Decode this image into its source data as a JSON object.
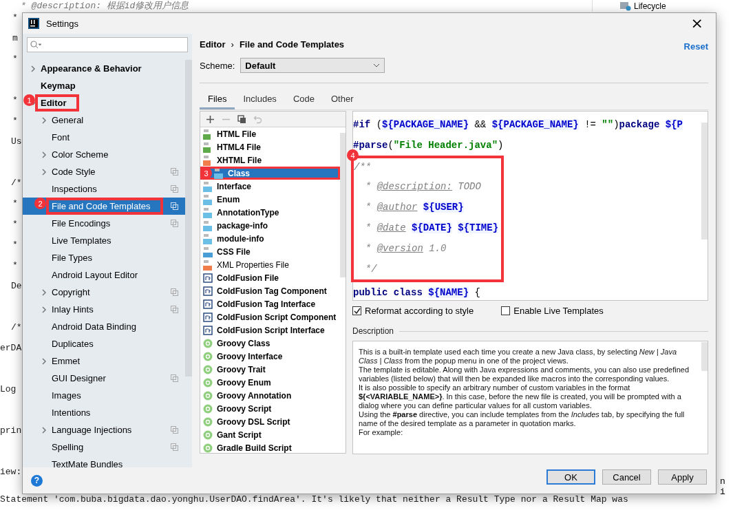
{
  "background_editor": {
    "lines": [
      {
        "text": "* @description: 根据id修改用户信息"
      },
      {
        "text": "*"
      },
      {
        "text": "m"
      },
      {
        "text": "*"
      },
      {
        "text": "*"
      },
      {
        "text": "*"
      },
      {
        "text": "Us"
      },
      {
        "text": "/*"
      },
      {
        "text": "*"
      },
      {
        "text": "*"
      },
      {
        "text": "*"
      },
      {
        "text": "*"
      },
      {
        "text": "De"
      },
      {
        "text": "/*"
      },
      {
        "text": "erDA"
      },
      {
        "text": "Log"
      },
      {
        "text": "prin"
      },
      {
        "text": "iew:"
      },
      {
        "text": "Statement 'com.buba.bigdata.dao.yonghu.UserDAO.findArea'. It's likely that neither a Result Type nor a Result Map was"
      }
    ],
    "project_tree_item": "Lifecycle",
    "right_fragment": "n i"
  },
  "window": {
    "title": "Settings",
    "close": "×"
  },
  "sidebar": {
    "items": [
      {
        "label": "Appearance & Behavior",
        "expandable": true,
        "expanded": false,
        "selected": false,
        "project_level": false
      },
      {
        "label": "Keymap",
        "expandable": false,
        "expanded": false,
        "selected": false,
        "project_level": false
      },
      {
        "label": "Editor",
        "expandable": true,
        "expanded": true,
        "selected": false,
        "project_level": false,
        "annotation": "1",
        "children": [
          {
            "label": "General",
            "expandable": true,
            "expanded": false,
            "selected": false,
            "project_level": false
          },
          {
            "label": "Font",
            "expandable": false,
            "expanded": false,
            "selected": false,
            "project_level": false
          },
          {
            "label": "Color Scheme",
            "expandable": true,
            "expanded": false,
            "selected": false,
            "project_level": false
          },
          {
            "label": "Code Style",
            "expandable": true,
            "expanded": false,
            "selected": false,
            "project_level": true
          },
          {
            "label": "Inspections",
            "expandable": false,
            "expanded": false,
            "selected": false,
            "project_level": true
          },
          {
            "label": "File and Code Templates",
            "expandable": false,
            "expanded": false,
            "selected": true,
            "project_level": true,
            "annotation": "2"
          },
          {
            "label": "File Encodings",
            "expandable": false,
            "expanded": false,
            "selected": false,
            "project_level": true
          },
          {
            "label": "Live Templates",
            "expandable": false,
            "expanded": false,
            "selected": false,
            "project_level": false
          },
          {
            "label": "File Types",
            "expandable": false,
            "expanded": false,
            "selected": false,
            "project_level": false
          },
          {
            "label": "Android Layout Editor",
            "expandable": false,
            "expanded": false,
            "selected": false,
            "project_level": false
          },
          {
            "label": "Copyright",
            "expandable": true,
            "expanded": false,
            "selected": false,
            "project_level": true
          },
          {
            "label": "Inlay Hints",
            "expandable": true,
            "expanded": false,
            "selected": false,
            "project_level": true
          },
          {
            "label": "Android Data Binding",
            "expandable": false,
            "expanded": false,
            "selected": false,
            "project_level": false
          },
          {
            "label": "Duplicates",
            "expandable": false,
            "expanded": false,
            "selected": false,
            "project_level": false
          },
          {
            "label": "Emmet",
            "expandable": true,
            "expanded": false,
            "selected": false,
            "project_level": false
          },
          {
            "label": "GUI Designer",
            "expandable": false,
            "expanded": false,
            "selected": false,
            "project_level": true
          },
          {
            "label": "Images",
            "expandable": false,
            "expanded": false,
            "selected": false,
            "project_level": false
          },
          {
            "label": "Intentions",
            "expandable": false,
            "expanded": false,
            "selected": false,
            "project_level": false
          },
          {
            "label": "Language Injections",
            "expandable": true,
            "expanded": false,
            "selected": false,
            "project_level": true
          },
          {
            "label": "Spelling",
            "expandable": false,
            "expanded": false,
            "selected": false,
            "project_level": true
          },
          {
            "label": "TextMate Bundles",
            "expandable": false,
            "expanded": false,
            "selected": false,
            "project_level": false
          }
        ]
      }
    ]
  },
  "breadcrumb": [
    "Editor",
    "File and Code Templates"
  ],
  "breadcrumb_separator": "›",
  "reset": "Reset",
  "scheme": {
    "label": "Scheme:",
    "value": "Default"
  },
  "tabs": [
    {
      "label": "Files",
      "selected": true
    },
    {
      "label": "Includes",
      "selected": false
    },
    {
      "label": "Code",
      "selected": false
    },
    {
      "label": "Other",
      "selected": false
    }
  ],
  "toolbar": [
    {
      "kind": "add",
      "disabled": false
    },
    {
      "kind": "remove",
      "disabled": true
    },
    {
      "kind": "copy",
      "disabled": false
    },
    {
      "kind": "reset",
      "disabled": true
    }
  ],
  "templates": [
    {
      "name": "HTML File",
      "kind": "html",
      "bold": true,
      "selected": false
    },
    {
      "name": "HTML4 File",
      "kind": "html",
      "bold": true,
      "selected": false
    },
    {
      "name": "XHTML File",
      "kind": "xhtml",
      "bold": true,
      "selected": false
    },
    {
      "name": "Class",
      "kind": "java",
      "bold": true,
      "selected": true,
      "annotation": "3"
    },
    {
      "name": "Interface",
      "kind": "java",
      "bold": true,
      "selected": false
    },
    {
      "name": "Enum",
      "kind": "java",
      "bold": true,
      "selected": false
    },
    {
      "name": "AnnotationType",
      "kind": "java",
      "bold": true,
      "selected": false
    },
    {
      "name": "package-info",
      "kind": "java",
      "bold": true,
      "selected": false
    },
    {
      "name": "module-info",
      "kind": "java",
      "bold": true,
      "selected": false
    },
    {
      "name": "CSS File",
      "kind": "css",
      "bold": true,
      "selected": false
    },
    {
      "name": "XML Properties File",
      "kind": "xml",
      "bold": false,
      "selected": false
    },
    {
      "name": "ColdFusion File",
      "kind": "cf",
      "bold": true,
      "selected": false
    },
    {
      "name": "ColdFusion Tag Component",
      "kind": "cf",
      "bold": true,
      "selected": false
    },
    {
      "name": "ColdFusion Tag Interface",
      "kind": "cf",
      "bold": true,
      "selected": false
    },
    {
      "name": "ColdFusion Script Component",
      "kind": "cf",
      "bold": true,
      "selected": false
    },
    {
      "name": "ColdFusion Script Interface",
      "kind": "cf",
      "bold": true,
      "selected": false
    },
    {
      "name": "Groovy Class",
      "kind": "groovy",
      "bold": true,
      "selected": false
    },
    {
      "name": "Groovy Interface",
      "kind": "groovy",
      "bold": true,
      "selected": false
    },
    {
      "name": "Groovy Trait",
      "kind": "groovy",
      "bold": true,
      "selected": false
    },
    {
      "name": "Groovy Enum",
      "kind": "groovy",
      "bold": true,
      "selected": false
    },
    {
      "name": "Groovy Annotation",
      "kind": "groovy",
      "bold": true,
      "selected": false
    },
    {
      "name": "Groovy Script",
      "kind": "groovy",
      "bold": true,
      "selected": false
    },
    {
      "name": "Groovy DSL Script",
      "kind": "groovy",
      "bold": true,
      "selected": false
    },
    {
      "name": "Gant Script",
      "kind": "groovy",
      "bold": true,
      "selected": false
    },
    {
      "name": "Gradle Build Script",
      "kind": "groovy",
      "bold": true,
      "selected": false
    }
  ],
  "code": [
    {
      "lines": [
        [
          {
            "kind": "directive",
            "text": "#if"
          },
          {
            "kind": "plain",
            "text": " ("
          },
          {
            "kind": "var",
            "text": "${PACKAGE_NAME}"
          },
          {
            "kind": "plain",
            "text": " && "
          },
          {
            "kind": "var",
            "text": "${PACKAGE_NAME}"
          },
          {
            "kind": "plain",
            "text": " != "
          },
          {
            "kind": "string",
            "text": "\"\""
          },
          {
            "kind": "plain",
            "text": ")"
          },
          {
            "kind": "keyword",
            "text": "package"
          },
          {
            "kind": "var",
            "text": " ${P"
          }
        ],
        [
          {
            "kind": "directive",
            "text": "#parse"
          },
          {
            "kind": "plain",
            "text": "("
          },
          {
            "kind": "string",
            "text": "\"File Header.java\""
          },
          {
            "kind": "plain",
            "text": ")"
          }
        ]
      ]
    },
    {
      "annotation": "4",
      "lines": [
        [
          {
            "kind": "comment",
            "text": "/**"
          }
        ],
        [
          {
            "kind": "comment",
            "text": "  * "
          },
          {
            "kind": "tag",
            "text": "@description:"
          },
          {
            "kind": "comment",
            "text": " TODO"
          }
        ],
        [
          {
            "kind": "comment",
            "text": "  * "
          },
          {
            "kind": "tag",
            "text": "@author"
          },
          {
            "kind": "var",
            "text": " ${USER}"
          }
        ],
        [
          {
            "kind": "comment",
            "text": "  * "
          },
          {
            "kind": "tag",
            "text": "@date"
          },
          {
            "kind": "var",
            "text": " ${DATE}"
          },
          {
            "kind": "var",
            "text": " ${TIME}"
          }
        ],
        [
          {
            "kind": "comment",
            "text": "  * "
          },
          {
            "kind": "tag",
            "text": "@version"
          },
          {
            "kind": "comment",
            "text": " 1.0"
          }
        ],
        [
          {
            "kind": "comment",
            "text": "  */"
          }
        ]
      ]
    },
    {
      "lines": [
        [
          {
            "kind": "keyword",
            "text": "public class"
          },
          {
            "kind": "var",
            "text": " ${NAME}"
          },
          {
            "kind": "plain",
            "text": " {"
          }
        ]
      ]
    }
  ],
  "options": [
    {
      "label": "Reformat according to style",
      "checked": true
    },
    {
      "label": "Enable Live Templates",
      "checked": false
    }
  ],
  "description": {
    "title": "Description",
    "paragraphs": [
      "This is a built-in template used each time you create a new Java class, by selecting *New | Java Class | Class* from the popup menu in one of the project views.",
      "The template is editable. Along with Java expressions and comments, you can also use predefined variables (listed below) that will then be expanded like macros into the corresponding values.",
      "It is also possible to specify an arbitrary number of custom variables in the format **${<VARIABLE_NAME>}**. In this case, before the new file is created, you will be prompted with a dialog where you can define particular values for all custom variables.",
      "Using the **#parse** directive, you can include templates from the *Includes* tab, by specifying the full name of the desired template as a parameter in quotation marks.",
      "For example:"
    ]
  },
  "buttons": [
    {
      "label": "OK",
      "default": true
    },
    {
      "label": "Cancel",
      "default": false
    },
    {
      "label": "Apply",
      "default": false
    }
  ],
  "help": "?"
}
